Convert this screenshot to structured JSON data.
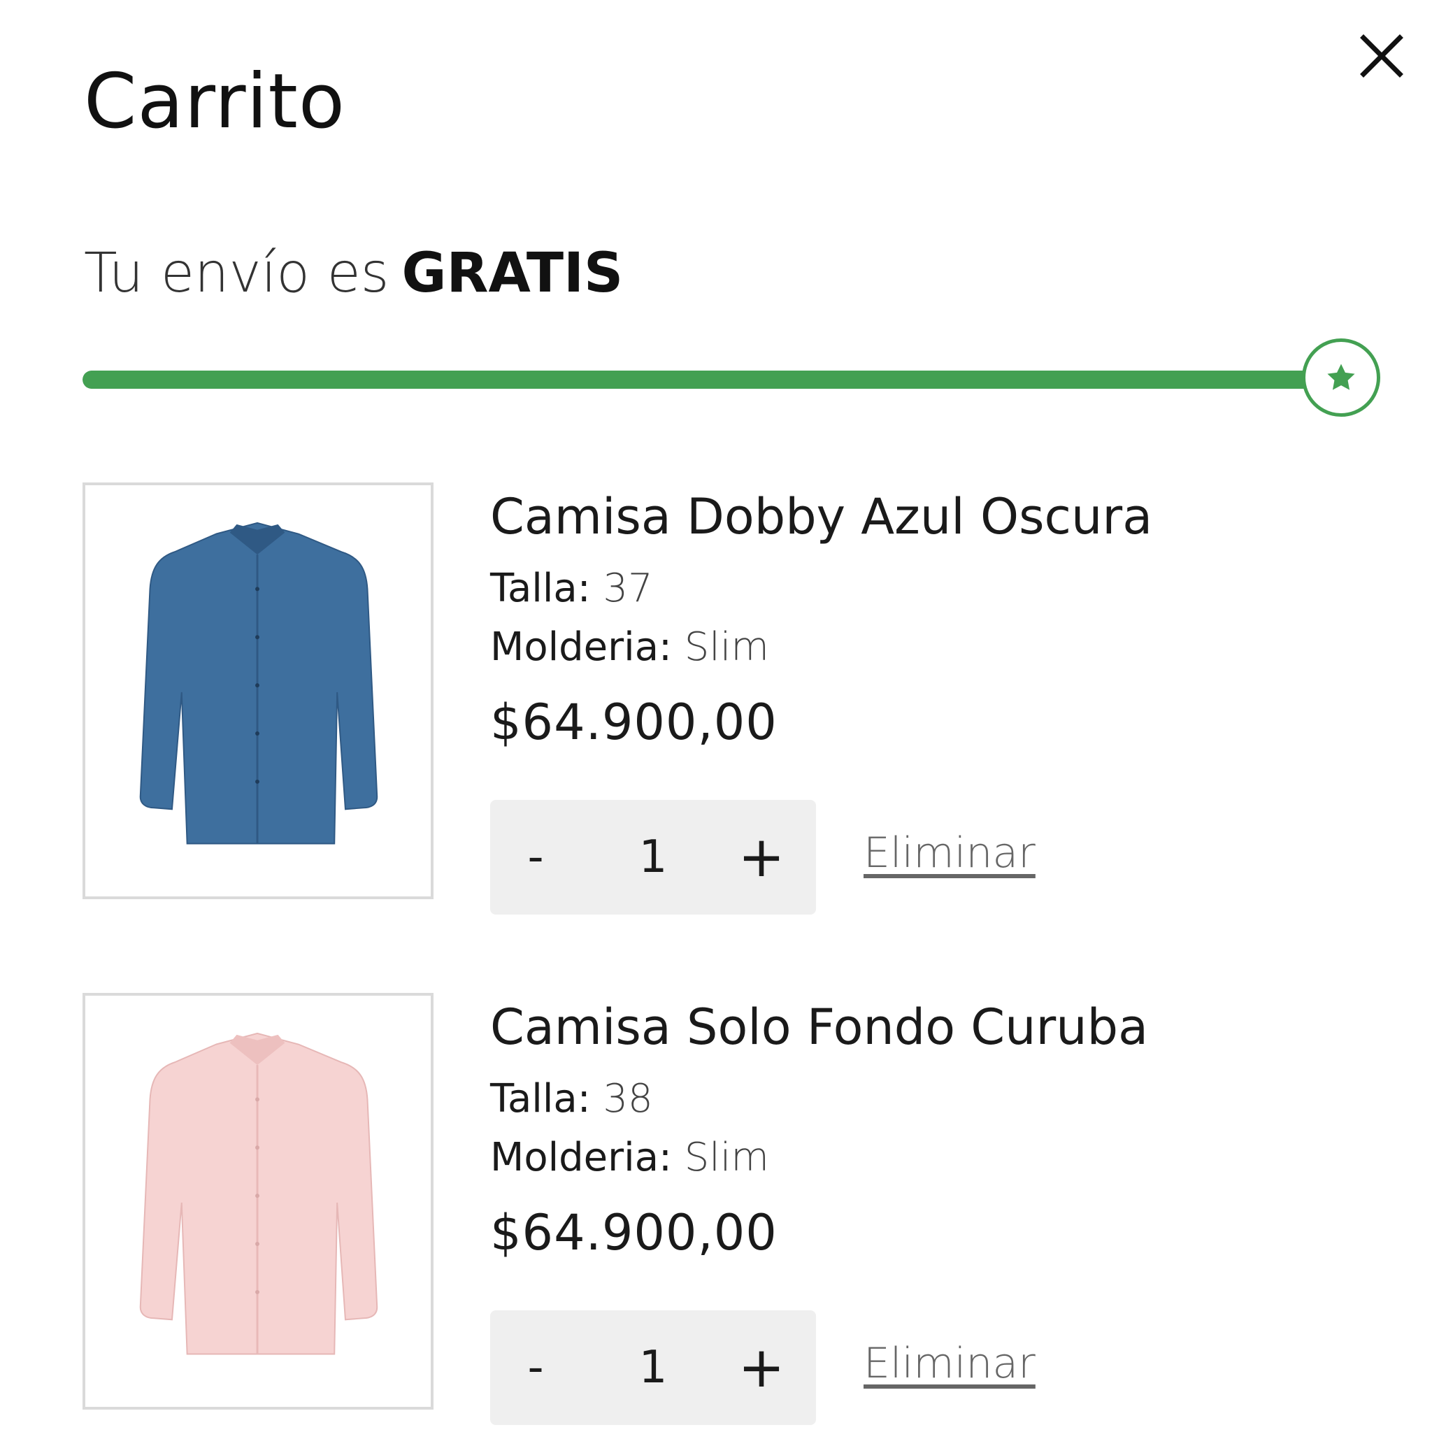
{
  "cart": {
    "title": "Carrito",
    "close_icon": "close-icon"
  },
  "shipping": {
    "prefix": "Tu envío es",
    "status": "GRATIS",
    "progress_percent": 100,
    "badge_icon": "star-icon",
    "accent_color": "#43a052"
  },
  "items": [
    {
      "name": "Camisa Dobby Azul Oscura",
      "size_label": "Talla:",
      "size_value": "37",
      "fit_label": "Molderia:",
      "fit_value": "Slim",
      "price": "$64.900,00",
      "quantity": "1",
      "minus_label": "-",
      "plus_label": "+",
      "remove_label": "Eliminar",
      "image_icon": "blue-shirt-image",
      "shirt_color": "#3e6f9e"
    },
    {
      "name": "Camisa Solo Fondo Curuba",
      "size_label": "Talla:",
      "size_value": "38",
      "fit_label": "Molderia:",
      "fit_value": "Slim",
      "price": "$64.900,00",
      "quantity": "1",
      "minus_label": "-",
      "plus_label": "+",
      "remove_label": "Eliminar",
      "image_icon": "pink-shirt-image",
      "shirt_color": "#f6d3d2"
    }
  ]
}
